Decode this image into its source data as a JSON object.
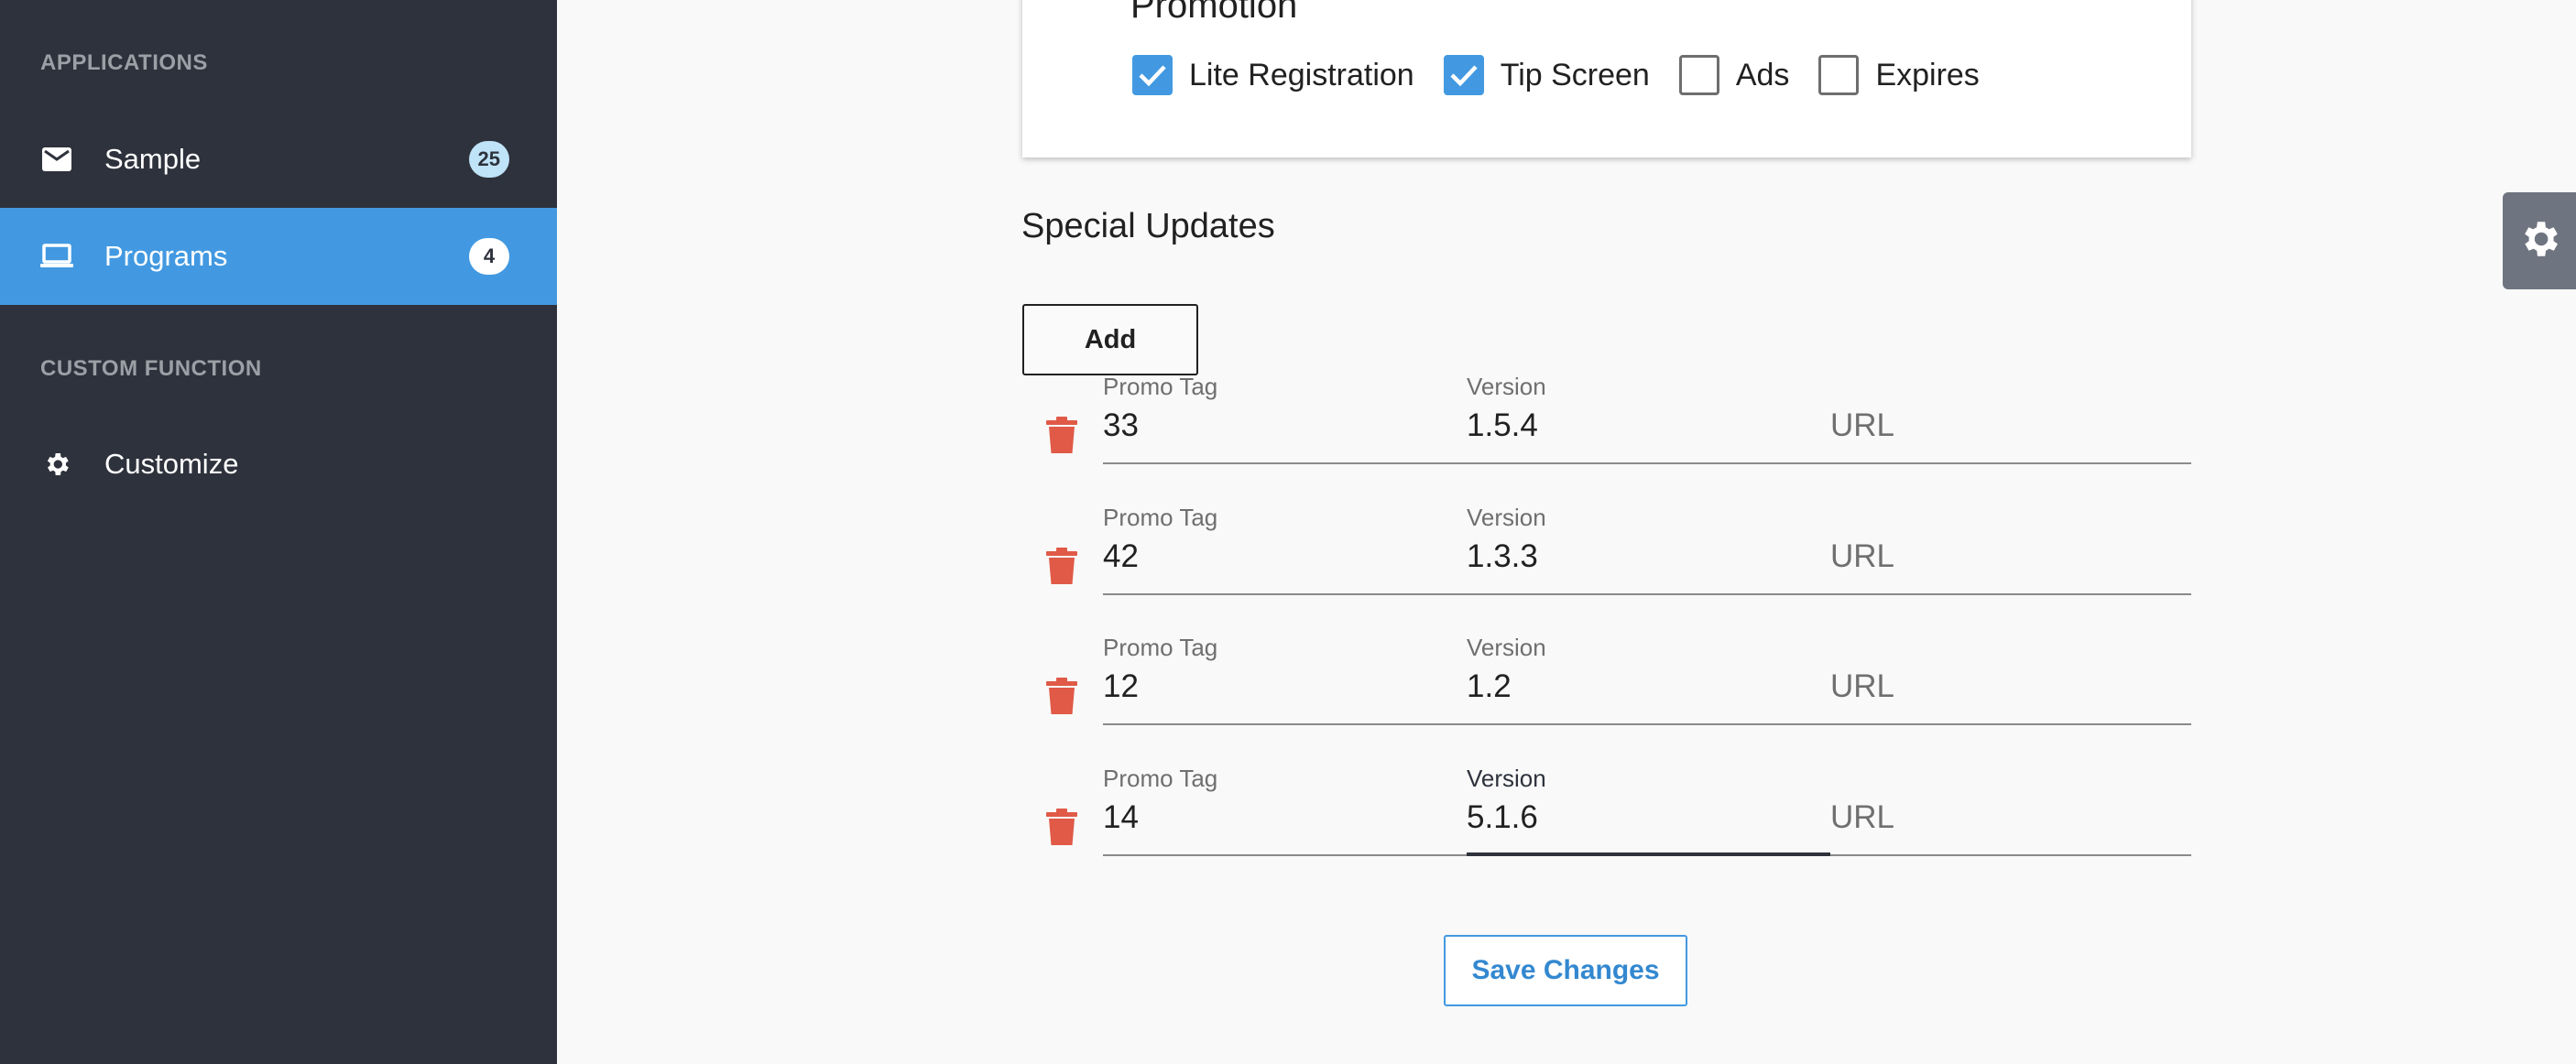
{
  "sidebar": {
    "sections": [
      {
        "title": "APPLICATIONS",
        "items": [
          {
            "label": "Sample",
            "icon": "mail-icon",
            "badge": "25",
            "active": false
          },
          {
            "label": "Programs",
            "icon": "laptop-icon",
            "badge": "4",
            "active": true
          }
        ]
      },
      {
        "title": "CUSTOM FUNCTION",
        "items": [
          {
            "label": "Customize",
            "icon": "gear-icon",
            "active": false
          }
        ]
      }
    ]
  },
  "promotion": {
    "title": "Promotion",
    "options": [
      {
        "label": "Lite Registration",
        "checked": true
      },
      {
        "label": "Tip Screen",
        "checked": true
      },
      {
        "label": "Ads",
        "checked": false
      },
      {
        "label": "Expires",
        "checked": false
      }
    ]
  },
  "special_updates": {
    "title": "Special Updates",
    "add_label": "Add",
    "rows": [
      {
        "promo_tag_label": "Promo Tag",
        "promo_tag": "33",
        "version_label": "Version",
        "version": "1.5.4",
        "url_placeholder": "URL"
      },
      {
        "promo_tag_label": "Promo Tag",
        "promo_tag": "42",
        "version_label": "Version",
        "version": "1.3.3",
        "url_placeholder": "URL"
      },
      {
        "promo_tag_label": "Promo Tag",
        "promo_tag": "12",
        "version_label": "Version",
        "version": "1.2",
        "url_placeholder": "URL"
      },
      {
        "promo_tag_label": "Promo Tag",
        "promo_tag": "14",
        "version_label": "Version",
        "version": "5.1.6",
        "url_placeholder": "URL",
        "version_focused": true
      }
    ]
  },
  "save_label": "Save Changes",
  "colors": {
    "sidebar_bg": "#2e323c",
    "accent": "#4299e1",
    "delete": "#e05a47",
    "page_bg": "#f9f9f9"
  }
}
